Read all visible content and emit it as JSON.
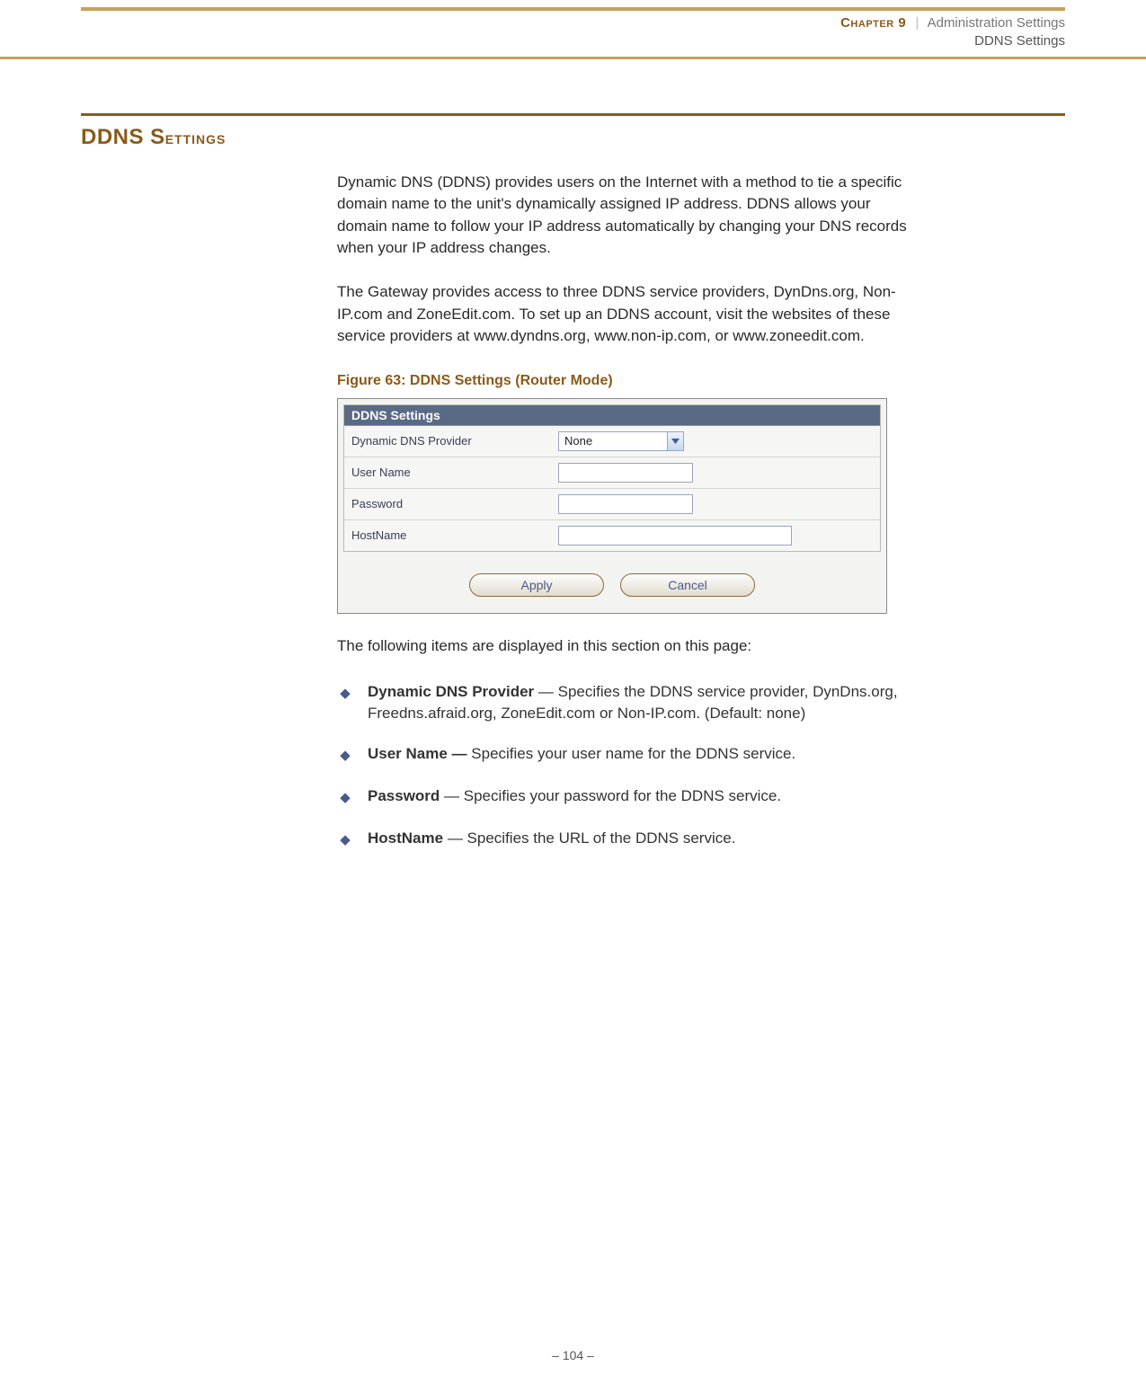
{
  "header": {
    "chapter_label": "Chapter 9",
    "separator": "|",
    "line1_right": "Administration Settings",
    "line2": "DDNS Settings"
  },
  "section": {
    "heading_big": "DDNS S",
    "heading_small": "ettings"
  },
  "paragraphs": {
    "p1": "Dynamic DNS (DDNS) provides users on the Internet with a method to tie a specific domain name to the unit's dynamically assigned IP address. DDNS allows your domain name to follow your IP address automatically by changing your DNS records when your IP address changes.",
    "p2": "The Gateway provides access to three DDNS service providers, DynDns.org, Non-IP.com and ZoneEdit.com. To set up an DDNS account, visit the websites of these service providers at www.dyndns.org, www.non-ip.com, or www.zoneedit.com.",
    "p3": "The following items are displayed in this section on this page:"
  },
  "figure": {
    "caption": "Figure 63:  DDNS Settings (Router Mode)",
    "titlebar": "DDNS Settings",
    "rows": {
      "provider_label": "Dynamic DNS Provider",
      "provider_value": "None",
      "username_label": "User Name",
      "username_value": "",
      "password_label": "Password",
      "password_value": "",
      "hostname_label": "HostName",
      "hostname_value": ""
    },
    "buttons": {
      "apply": "Apply",
      "cancel": "Cancel"
    }
  },
  "list": {
    "i1_term": "Dynamic DNS Provider",
    "i1_rest": " — Specifies the DDNS service provider, DynDns.org, Freedns.afraid.org, ZoneEdit.com or Non-IP.com. (Default: none)",
    "i2_term": "User Name —",
    "i2_rest": " Specifies your user name for the DDNS service.",
    "i3_term": "Password",
    "i3_rest": " — Specifies your password for the DDNS service.",
    "i4_term": "HostName",
    "i4_rest": " — Specifies the URL of the DDNS service."
  },
  "footer": {
    "page": "–  104  –"
  }
}
